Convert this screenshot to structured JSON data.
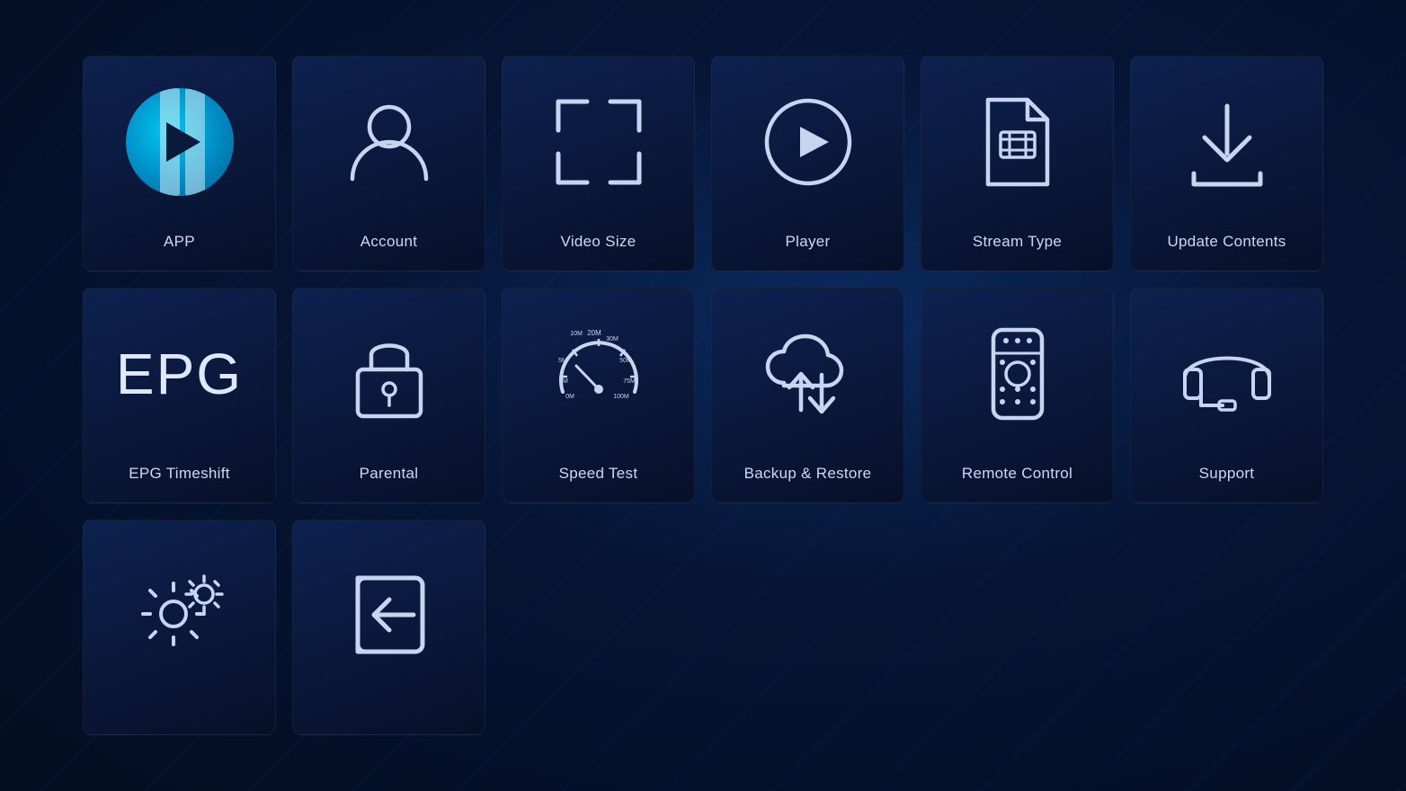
{
  "tiles": [
    {
      "id": "app",
      "label": "APP",
      "row": 1
    },
    {
      "id": "account",
      "label": "Account",
      "row": 1
    },
    {
      "id": "video-size",
      "label": "Video Size",
      "row": 1
    },
    {
      "id": "player",
      "label": "Player",
      "row": 1
    },
    {
      "id": "stream-type",
      "label": "Stream Type",
      "row": 1
    },
    {
      "id": "update-contents",
      "label": "Update Contents",
      "row": 1
    },
    {
      "id": "epg-timeshift",
      "label": "EPG Timeshift",
      "row": 2
    },
    {
      "id": "parental",
      "label": "Parental",
      "row": 2
    },
    {
      "id": "speed-test",
      "label": "Speed Test",
      "row": 2
    },
    {
      "id": "backup-restore",
      "label": "Backup & Restore",
      "row": 2
    },
    {
      "id": "remote-control",
      "label": "Remote Control",
      "row": 2
    },
    {
      "id": "support",
      "label": "Support",
      "row": 2
    },
    {
      "id": "settings",
      "label": "",
      "row": 3
    },
    {
      "id": "logout",
      "label": "",
      "row": 3
    }
  ]
}
